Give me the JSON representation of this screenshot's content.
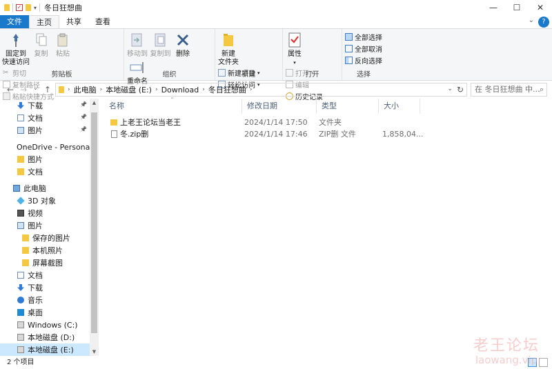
{
  "window": {
    "title": "冬日狂想曲",
    "controls": [
      "—",
      "☐",
      "✕"
    ]
  },
  "ribbon_tabs": [
    "文件",
    "主页",
    "共享",
    "查看"
  ],
  "ribbon": {
    "clipboard": {
      "pin": "固定到\n快速访问",
      "copy": "复制",
      "paste": "粘贴",
      "cut": "剪切",
      "copy_path": "复制路径",
      "paste_shortcut": "粘贴快捷方式",
      "label": "剪贴板"
    },
    "organize": {
      "move_to": "移动到",
      "copy_to": "复制到",
      "delete": "删除",
      "rename": "重命名",
      "label": "组织"
    },
    "new": {
      "new_folder": "新建\n文件夹",
      "new_item": "新建项目",
      "easy_access": "轻松访问",
      "label": "新建"
    },
    "open": {
      "properties": "属性",
      "open": "打开",
      "edit": "编辑",
      "history": "历史记录",
      "label": "打开"
    },
    "select": {
      "select_all": "全部选择",
      "select_none": "全部取消",
      "invert": "反向选择",
      "label": "选择"
    }
  },
  "address": {
    "crumbs": [
      "此电脑",
      "本地磁盘 (E:)",
      "Download",
      "冬日狂想曲"
    ],
    "search_placeholder": "在 冬日狂想曲 中..."
  },
  "nav": [
    {
      "label": "下载",
      "icon": "download-icon",
      "pinned": true,
      "indent": 1
    },
    {
      "label": "文档",
      "icon": "document-icon",
      "pinned": true,
      "indent": 1
    },
    {
      "label": "图片",
      "icon": "picture-icon",
      "pinned": true,
      "indent": 1
    },
    {
      "label": "OneDrive - Personal",
      "icon": "onedrive-icon",
      "indent": 0
    },
    {
      "label": "图片",
      "icon": "folder-icon",
      "indent": 1
    },
    {
      "label": "文档",
      "icon": "folder-icon",
      "indent": 1
    },
    {
      "label": "此电脑",
      "icon": "this-pc-icon",
      "indent": 0
    },
    {
      "label": "3D 对象",
      "icon": "3d-objects-icon",
      "indent": 1
    },
    {
      "label": "视频",
      "icon": "video-icon",
      "indent": 1
    },
    {
      "label": "图片",
      "icon": "picture-icon",
      "indent": 1
    },
    {
      "label": "保存的图片",
      "icon": "folder-icon",
      "indent": 2
    },
    {
      "label": "本机照片",
      "icon": "folder-icon",
      "indent": 2
    },
    {
      "label": "屏幕截图",
      "icon": "folder-icon",
      "indent": 2
    },
    {
      "label": "文档",
      "icon": "document-icon",
      "indent": 1
    },
    {
      "label": "下载",
      "icon": "download-icon",
      "indent": 1
    },
    {
      "label": "音乐",
      "icon": "music-icon",
      "indent": 1
    },
    {
      "label": "桌面",
      "icon": "desktop-icon",
      "indent": 1
    },
    {
      "label": "Windows (C:)",
      "icon": "drive-icon",
      "indent": 1
    },
    {
      "label": "本地磁盘 (D:)",
      "icon": "drive-icon",
      "indent": 1
    },
    {
      "label": "本地磁盘 (E:)",
      "icon": "drive-icon",
      "indent": 1,
      "selected": true
    }
  ],
  "columns": [
    "名称",
    "修改日期",
    "类型",
    "大小"
  ],
  "files": [
    {
      "name": "上老王论坛当老王",
      "date": "2024/1/14 17:50",
      "type": "文件夹",
      "size": "",
      "icon": "folder-icon"
    },
    {
      "name": "冬.zip删",
      "date": "2024/1/14 17:46",
      "type": "ZIP删 文件",
      "size": "1,858,04...",
      "icon": "zip-file-icon"
    }
  ],
  "status": {
    "item_count": "2 个项目"
  },
  "watermark": {
    "line1": "老王论坛",
    "line2": "laowang.vip"
  }
}
